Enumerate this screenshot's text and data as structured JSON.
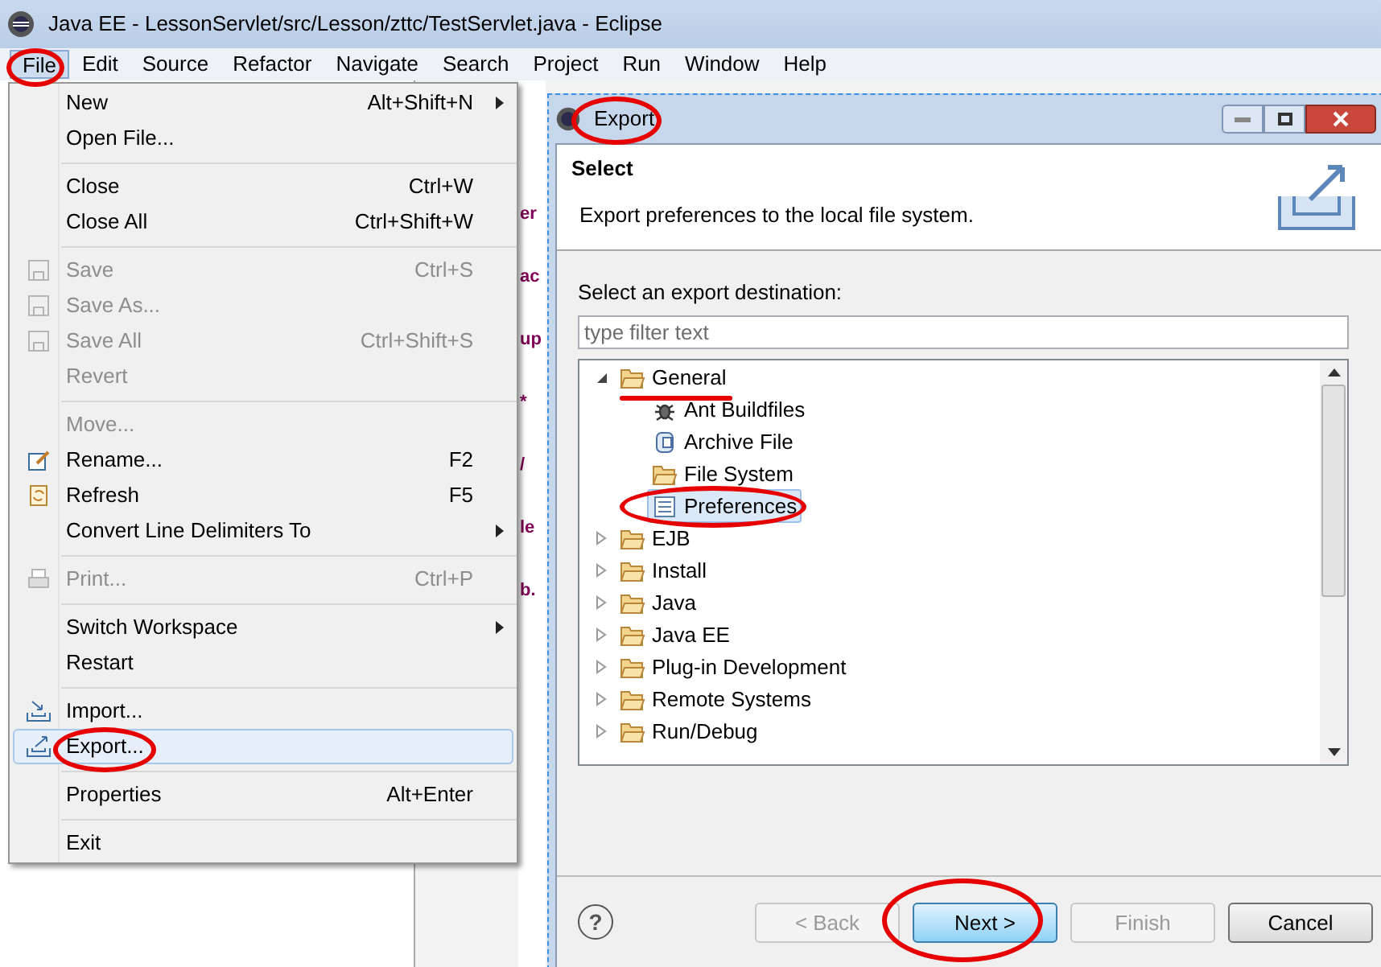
{
  "window": {
    "title": "Java EE - LessonServlet/src/Lesson/zttc/TestServlet.java - Eclipse"
  },
  "menu_bar": [
    {
      "label": "File",
      "selected": true
    },
    {
      "label": "Edit",
      "selected": false
    },
    {
      "label": "Source",
      "selected": false
    },
    {
      "label": "Refactor",
      "selected": false
    },
    {
      "label": "Navigate",
      "selected": false
    },
    {
      "label": "Search",
      "selected": false
    },
    {
      "label": "Project",
      "selected": false
    },
    {
      "label": "Run",
      "selected": false
    },
    {
      "label": "Window",
      "selected": false
    },
    {
      "label": "Help",
      "selected": false
    }
  ],
  "editor_fragments": [
    "er",
    "ac",
    "up",
    "*",
    "/",
    "le",
    "b."
  ],
  "file_menu": [
    {
      "kind": "item",
      "label": "New",
      "shortcut": "Alt+Shift+N",
      "submenu": true,
      "disabled": false,
      "selected": false
    },
    {
      "kind": "item",
      "label": "Open File...",
      "disabled": false,
      "selected": false
    },
    {
      "kind": "separator"
    },
    {
      "kind": "item",
      "label": "Close",
      "shortcut": "Ctrl+W",
      "disabled": false,
      "selected": false
    },
    {
      "kind": "item",
      "label": "Close All",
      "shortcut": "Ctrl+Shift+W",
      "disabled": false,
      "selected": false
    },
    {
      "kind": "separator"
    },
    {
      "kind": "item",
      "label": "Save",
      "shortcut": "Ctrl+S",
      "disabled": true,
      "selected": false
    },
    {
      "kind": "item",
      "label": "Save As...",
      "disabled": true,
      "selected": false
    },
    {
      "kind": "item",
      "label": "Save All",
      "shortcut": "Ctrl+Shift+S",
      "disabled": true,
      "selected": false
    },
    {
      "kind": "item",
      "label": "Revert",
      "disabled": true,
      "selected": false
    },
    {
      "kind": "separator"
    },
    {
      "kind": "item",
      "label": "Move...",
      "disabled": true,
      "selected": false
    },
    {
      "kind": "item",
      "label": "Rename...",
      "shortcut": "F2",
      "disabled": false,
      "selected": false
    },
    {
      "kind": "item",
      "label": "Refresh",
      "shortcut": "F5",
      "disabled": false,
      "selected": false
    },
    {
      "kind": "item",
      "label": "Convert Line Delimiters To",
      "submenu": true,
      "disabled": false,
      "selected": false
    },
    {
      "kind": "separator"
    },
    {
      "kind": "item",
      "label": "Print...",
      "shortcut": "Ctrl+P",
      "disabled": true,
      "selected": false
    },
    {
      "kind": "separator"
    },
    {
      "kind": "item",
      "label": "Switch Workspace",
      "submenu": true,
      "disabled": false,
      "selected": false
    },
    {
      "kind": "item",
      "label": "Restart",
      "disabled": false,
      "selected": false
    },
    {
      "kind": "separator"
    },
    {
      "kind": "item",
      "label": "Import...",
      "disabled": false,
      "selected": false
    },
    {
      "kind": "item",
      "label": "Export...",
      "disabled": false,
      "selected": true
    },
    {
      "kind": "separator"
    },
    {
      "kind": "item",
      "label": "Properties",
      "shortcut": "Alt+Enter",
      "disabled": false,
      "selected": false
    },
    {
      "kind": "separator"
    },
    {
      "kind": "item",
      "label": "Exit",
      "disabled": false,
      "selected": false
    }
  ],
  "dialog": {
    "title": "Export",
    "heading": "Select",
    "description": "Export preferences to the local file system.",
    "list_label": "Select an export destination:",
    "filter": {
      "placeholder": "type filter text"
    },
    "tree": [
      {
        "label": "General",
        "expanded": true,
        "selected": false,
        "children": [
          {
            "label": "Ant Buildfiles",
            "selected": false
          },
          {
            "label": "Archive File",
            "selected": false
          },
          {
            "label": "File System",
            "selected": false
          },
          {
            "label": "Preferences",
            "selected": true
          }
        ]
      },
      {
        "label": "EJB",
        "expanded": false,
        "selected": false
      },
      {
        "label": "Install",
        "expanded": false,
        "selected": false
      },
      {
        "label": "Java",
        "expanded": false,
        "selected": false
      },
      {
        "label": "Java EE",
        "expanded": false,
        "selected": false
      },
      {
        "label": "Plug-in Development",
        "expanded": false,
        "selected": false
      },
      {
        "label": "Remote Systems",
        "expanded": false,
        "selected": false
      },
      {
        "label": "Run/Debug",
        "expanded": false,
        "selected": false
      }
    ],
    "help": {
      "label": "?"
    },
    "buttons": [
      {
        "label": "< Back",
        "disabled": true,
        "default": false
      },
      {
        "label": "Next >",
        "disabled": false,
        "default": true
      },
      {
        "label": "Finish",
        "disabled": true,
        "default": false
      },
      {
        "label": "Cancel",
        "disabled": false,
        "default": false
      }
    ]
  }
}
